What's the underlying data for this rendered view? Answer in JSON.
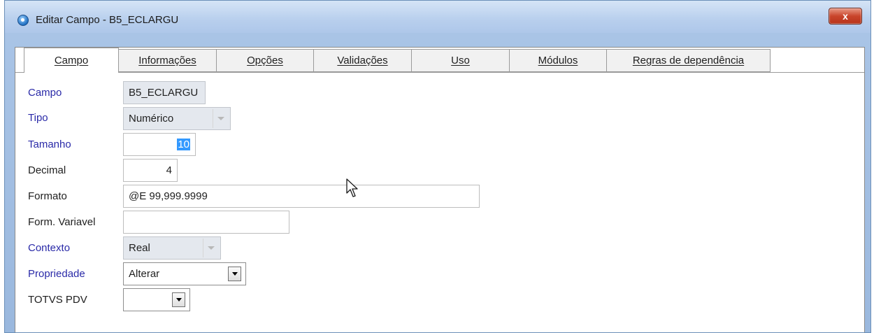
{
  "window": {
    "title": "Editar Campo - B5_ECLARGU",
    "close_label": "x"
  },
  "tabs": [
    {
      "label": "Campo",
      "active": true
    },
    {
      "label": "Informações",
      "active": false
    },
    {
      "label": "Opções",
      "active": false
    },
    {
      "label": "Validações",
      "active": false
    },
    {
      "label": "Uso",
      "active": false
    },
    {
      "label": "Módulos",
      "active": false
    },
    {
      "label": "Regras de dependência",
      "active": false
    }
  ],
  "form": {
    "campo": {
      "label": "Campo",
      "value": "B5_ECLARGU"
    },
    "tipo": {
      "label": "Tipo",
      "value": "Numérico"
    },
    "tamanho": {
      "label": "Tamanho",
      "value": "10"
    },
    "decimal": {
      "label": "Decimal",
      "value": "4"
    },
    "formato": {
      "label": "Formato",
      "value": "@E 99,999.9999"
    },
    "form_variavel": {
      "label": "Form. Variavel",
      "value": ""
    },
    "contexto": {
      "label": "Contexto",
      "value": "Real"
    },
    "propriedade": {
      "label": "Propriedade",
      "value": "Alterar"
    },
    "totvs_pdv": {
      "label": "TOTVS PDV",
      "value": ""
    }
  },
  "colors": {
    "required_label": "#2a2aa8",
    "selection": "#3399ff",
    "titlebar": "#b8cfed"
  },
  "icons": {
    "app": "globe-icon",
    "close": "close-icon",
    "cursor": "mouse-pointer-icon"
  }
}
